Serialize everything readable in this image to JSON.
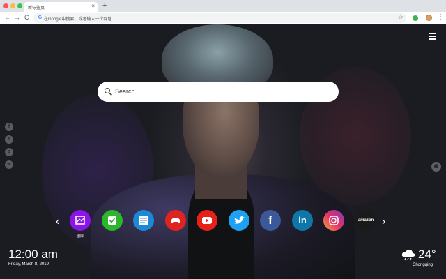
{
  "browser": {
    "tab_title": "新标签页",
    "tab_close": "×",
    "new_tab": "+",
    "back": "←",
    "forward": "→",
    "reload": "C",
    "search_engine_letter": "G",
    "omnibox_text": "在Google中搜索，或者输入一个网址",
    "bookmark_star": "☆",
    "menu": "⋮"
  },
  "page": {
    "search_placeholder": "Search",
    "social_icons": [
      "facebook-icon",
      "twitter-icon",
      "qq-icon",
      "wechat-icon"
    ],
    "social_glyphs": [
      "f",
      "t",
      "q",
      "w"
    ],
    "prev_arrow": "‹",
    "next_arrow": "›",
    "apps": [
      {
        "name": "gallery-app",
        "label": "图库",
        "color": "#8a15e8"
      },
      {
        "name": "tasks-app",
        "label": "",
        "color": "#2db52b"
      },
      {
        "name": "news-app",
        "label": "",
        "color": "#1e88d8"
      },
      {
        "name": "game-app",
        "label": "",
        "color": "#e0231e"
      },
      {
        "name": "youtube-app",
        "label": "",
        "color": "#e62117"
      },
      {
        "name": "twitter-app",
        "label": "",
        "color": "#1da1f2"
      },
      {
        "name": "facebook-app",
        "label": "",
        "color": "#3b5998"
      },
      {
        "name": "linkedin-app",
        "label": "",
        "color": "#0e76a8"
      },
      {
        "name": "instagram-app",
        "label": "",
        "color": "#c13584"
      },
      {
        "name": "amazon-app",
        "label": "amazon",
        "color": "#1a1a1a"
      }
    ],
    "clock": "12:00 am",
    "date": "Friday, March 8, 2019",
    "weather": {
      "temp": "24°",
      "city": "Chongqing",
      "icon": "cloud-rain-icon"
    }
  }
}
